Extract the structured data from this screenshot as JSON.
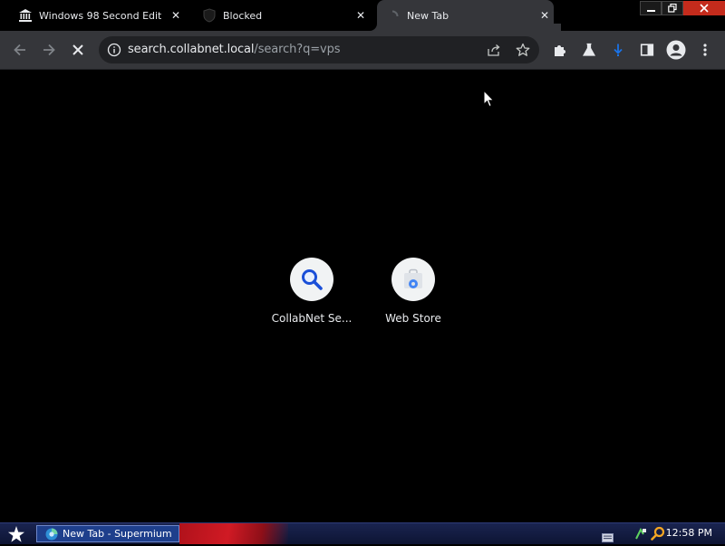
{
  "tabs": [
    {
      "title": "Windows 98 Second Edition",
      "icon": "institution-icon",
      "close": "✕"
    },
    {
      "title": "Blocked",
      "icon": "shield-icon",
      "close": "✕"
    },
    {
      "title": "New Tab",
      "icon": "loading-spinner-icon",
      "close": "✕",
      "active": true
    }
  ],
  "window_controls": {
    "minimize": "—",
    "restore": "❐",
    "close": "✕"
  },
  "toolbar": {
    "back": "back-arrow-icon",
    "forward": "forward-arrow-icon",
    "stop": "stop-icon",
    "site_info": "info-icon",
    "url_host": "search.collabnet.local",
    "url_path": "/search?q=vps",
    "share": "share-icon",
    "bookmark": "star-icon",
    "extensions": "puzzle-icon",
    "labs": "flask-icon",
    "downloads": "download-icon",
    "side_panel": "side-panel-icon",
    "profile": "avatar-icon",
    "menu": "kebab-menu-icon"
  },
  "shortcuts": [
    {
      "label": "CollabNet Se...",
      "icon": "search-icon"
    },
    {
      "label": "Web Store",
      "icon": "web-store-icon"
    }
  ],
  "taskbar": {
    "start_icon": "star-icon",
    "task_label": "New Tab - Supermium",
    "clock": "12:58 PM",
    "tray_icons": [
      "keyboard-icon",
      "network-icon",
      "search-icon"
    ]
  },
  "colors": {
    "tab_active_bg": "#35363a",
    "toolbar_bg": "#35363a",
    "omnibox_bg": "#202124",
    "content_bg": "#000000",
    "accent_blue": "#1a73e8",
    "taskbar_bg": "#1a2450"
  }
}
